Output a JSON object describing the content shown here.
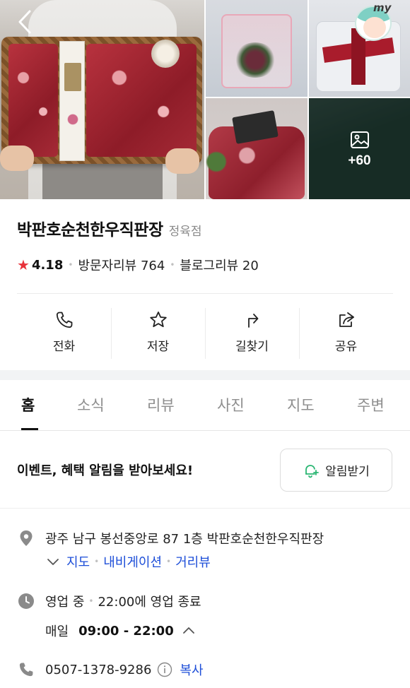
{
  "gallery": {
    "more_count": "+60"
  },
  "profile": {
    "badge_label": "my"
  },
  "place": {
    "name": "박판호순천한우직판장",
    "category": "정육점",
    "rating": "4.18",
    "visitor_reviews": "방문자리뷰 764",
    "blog_reviews": "블로그리뷰 20"
  },
  "actions": [
    {
      "label": "전화",
      "icon": "phone-icon"
    },
    {
      "label": "저장",
      "icon": "star-icon"
    },
    {
      "label": "길찾기",
      "icon": "directions-icon"
    },
    {
      "label": "공유",
      "icon": "share-icon"
    }
  ],
  "tabs": [
    {
      "label": "홈",
      "active": true
    },
    {
      "label": "소식",
      "active": false
    },
    {
      "label": "리뷰",
      "active": false
    },
    {
      "label": "사진",
      "active": false
    },
    {
      "label": "지도",
      "active": false
    },
    {
      "label": "주변",
      "active": false
    }
  ],
  "notice": {
    "text": "이벤트, 혜택 알림을 받아보세요!",
    "button_label": "알림받기"
  },
  "info": {
    "address": "광주 남구 봉선중앙로 87 1층 박판호순천한우직판장",
    "address_links": [
      "지도",
      "내비게이션",
      "거리뷰"
    ],
    "status": "영업 중",
    "status_detail": "22:00에 영업 종료",
    "hours_day": "매일",
    "hours_time": "09:00 - 22:00",
    "phone": "0507-1378-9286",
    "copy_label": "복사"
  },
  "colors": {
    "accent_star": "#e8323a",
    "link": "#1d4ed8",
    "bell": "#2bb673"
  }
}
